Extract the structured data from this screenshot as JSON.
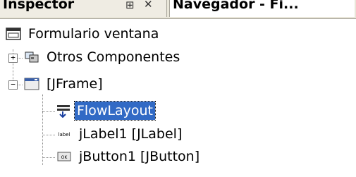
{
  "tabs": {
    "inspector": {
      "label": "Inspector",
      "pin_icon": "pin-icon",
      "close_icon": "close-icon"
    },
    "navegador": {
      "label": "Navegador - Fi..."
    }
  },
  "tree": {
    "root": {
      "label": "Formulario ventana",
      "icon": "form-icon"
    },
    "otros": {
      "label": "Otros Componentes",
      "icon": "components-icon"
    },
    "jframe": {
      "label": "[JFrame]",
      "icon": "frame-icon"
    },
    "flowlayout": {
      "label": "FlowLayout",
      "icon": "layout-icon"
    },
    "jlabel": {
      "label": "jLabel1 [JLabel]",
      "icon": "label-icon",
      "icon_text": "label"
    },
    "jbutton": {
      "label": "jButton1 [JButton]",
      "icon": "button-icon",
      "icon_text": "OK"
    }
  },
  "colors": {
    "selection": "#316ac5",
    "tabbar": "#e9e6d9"
  }
}
